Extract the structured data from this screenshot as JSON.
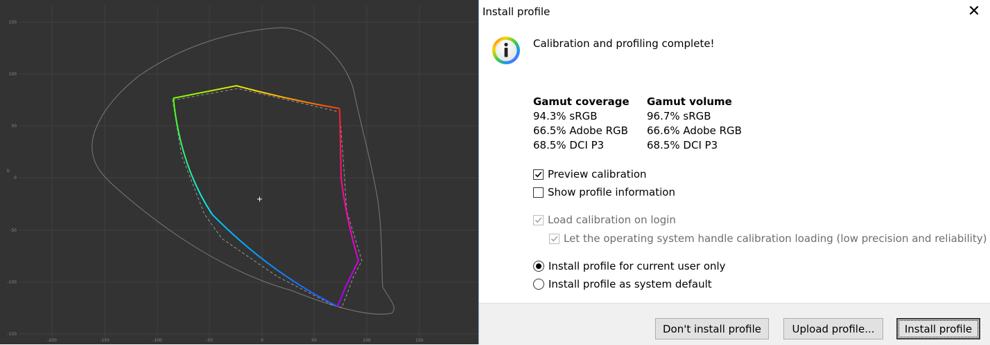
{
  "plot": {
    "y_ticks": [
      "150",
      "100",
      "50",
      "0",
      "-50",
      "-100",
      "-150"
    ],
    "x_ticks": [
      "-200",
      "-150",
      "-100",
      "-50",
      "0",
      "50",
      "100",
      "150"
    ],
    "y_axis_label": "b"
  },
  "dialog": {
    "title": "Install profile",
    "close_glyph": "✕",
    "icon": "info-icon",
    "message": "Calibration and profiling complete!",
    "gamut_coverage": {
      "heading": "Gamut coverage",
      "rows": [
        "94.3% sRGB",
        "66.5% Adobe RGB",
        "68.5% DCI P3"
      ]
    },
    "gamut_volume": {
      "heading": "Gamut volume",
      "rows": [
        "96.7% sRGB",
        "66.6% Adobe RGB",
        "68.5% DCI P3"
      ]
    },
    "options": {
      "preview_calibration": "Preview calibration",
      "show_profile_information": "Show profile information",
      "load_calibration_on_login": "Load calibration on login",
      "os_handle_calibration": "Let the operating system handle calibration loading (low precision and reliability)",
      "install_current_user": "Install profile for current user only",
      "install_system_default": "Install profile as system default"
    },
    "buttons": {
      "dont_install": "Don't install profile",
      "upload": "Upload profile...",
      "install": "Install profile"
    }
  }
}
